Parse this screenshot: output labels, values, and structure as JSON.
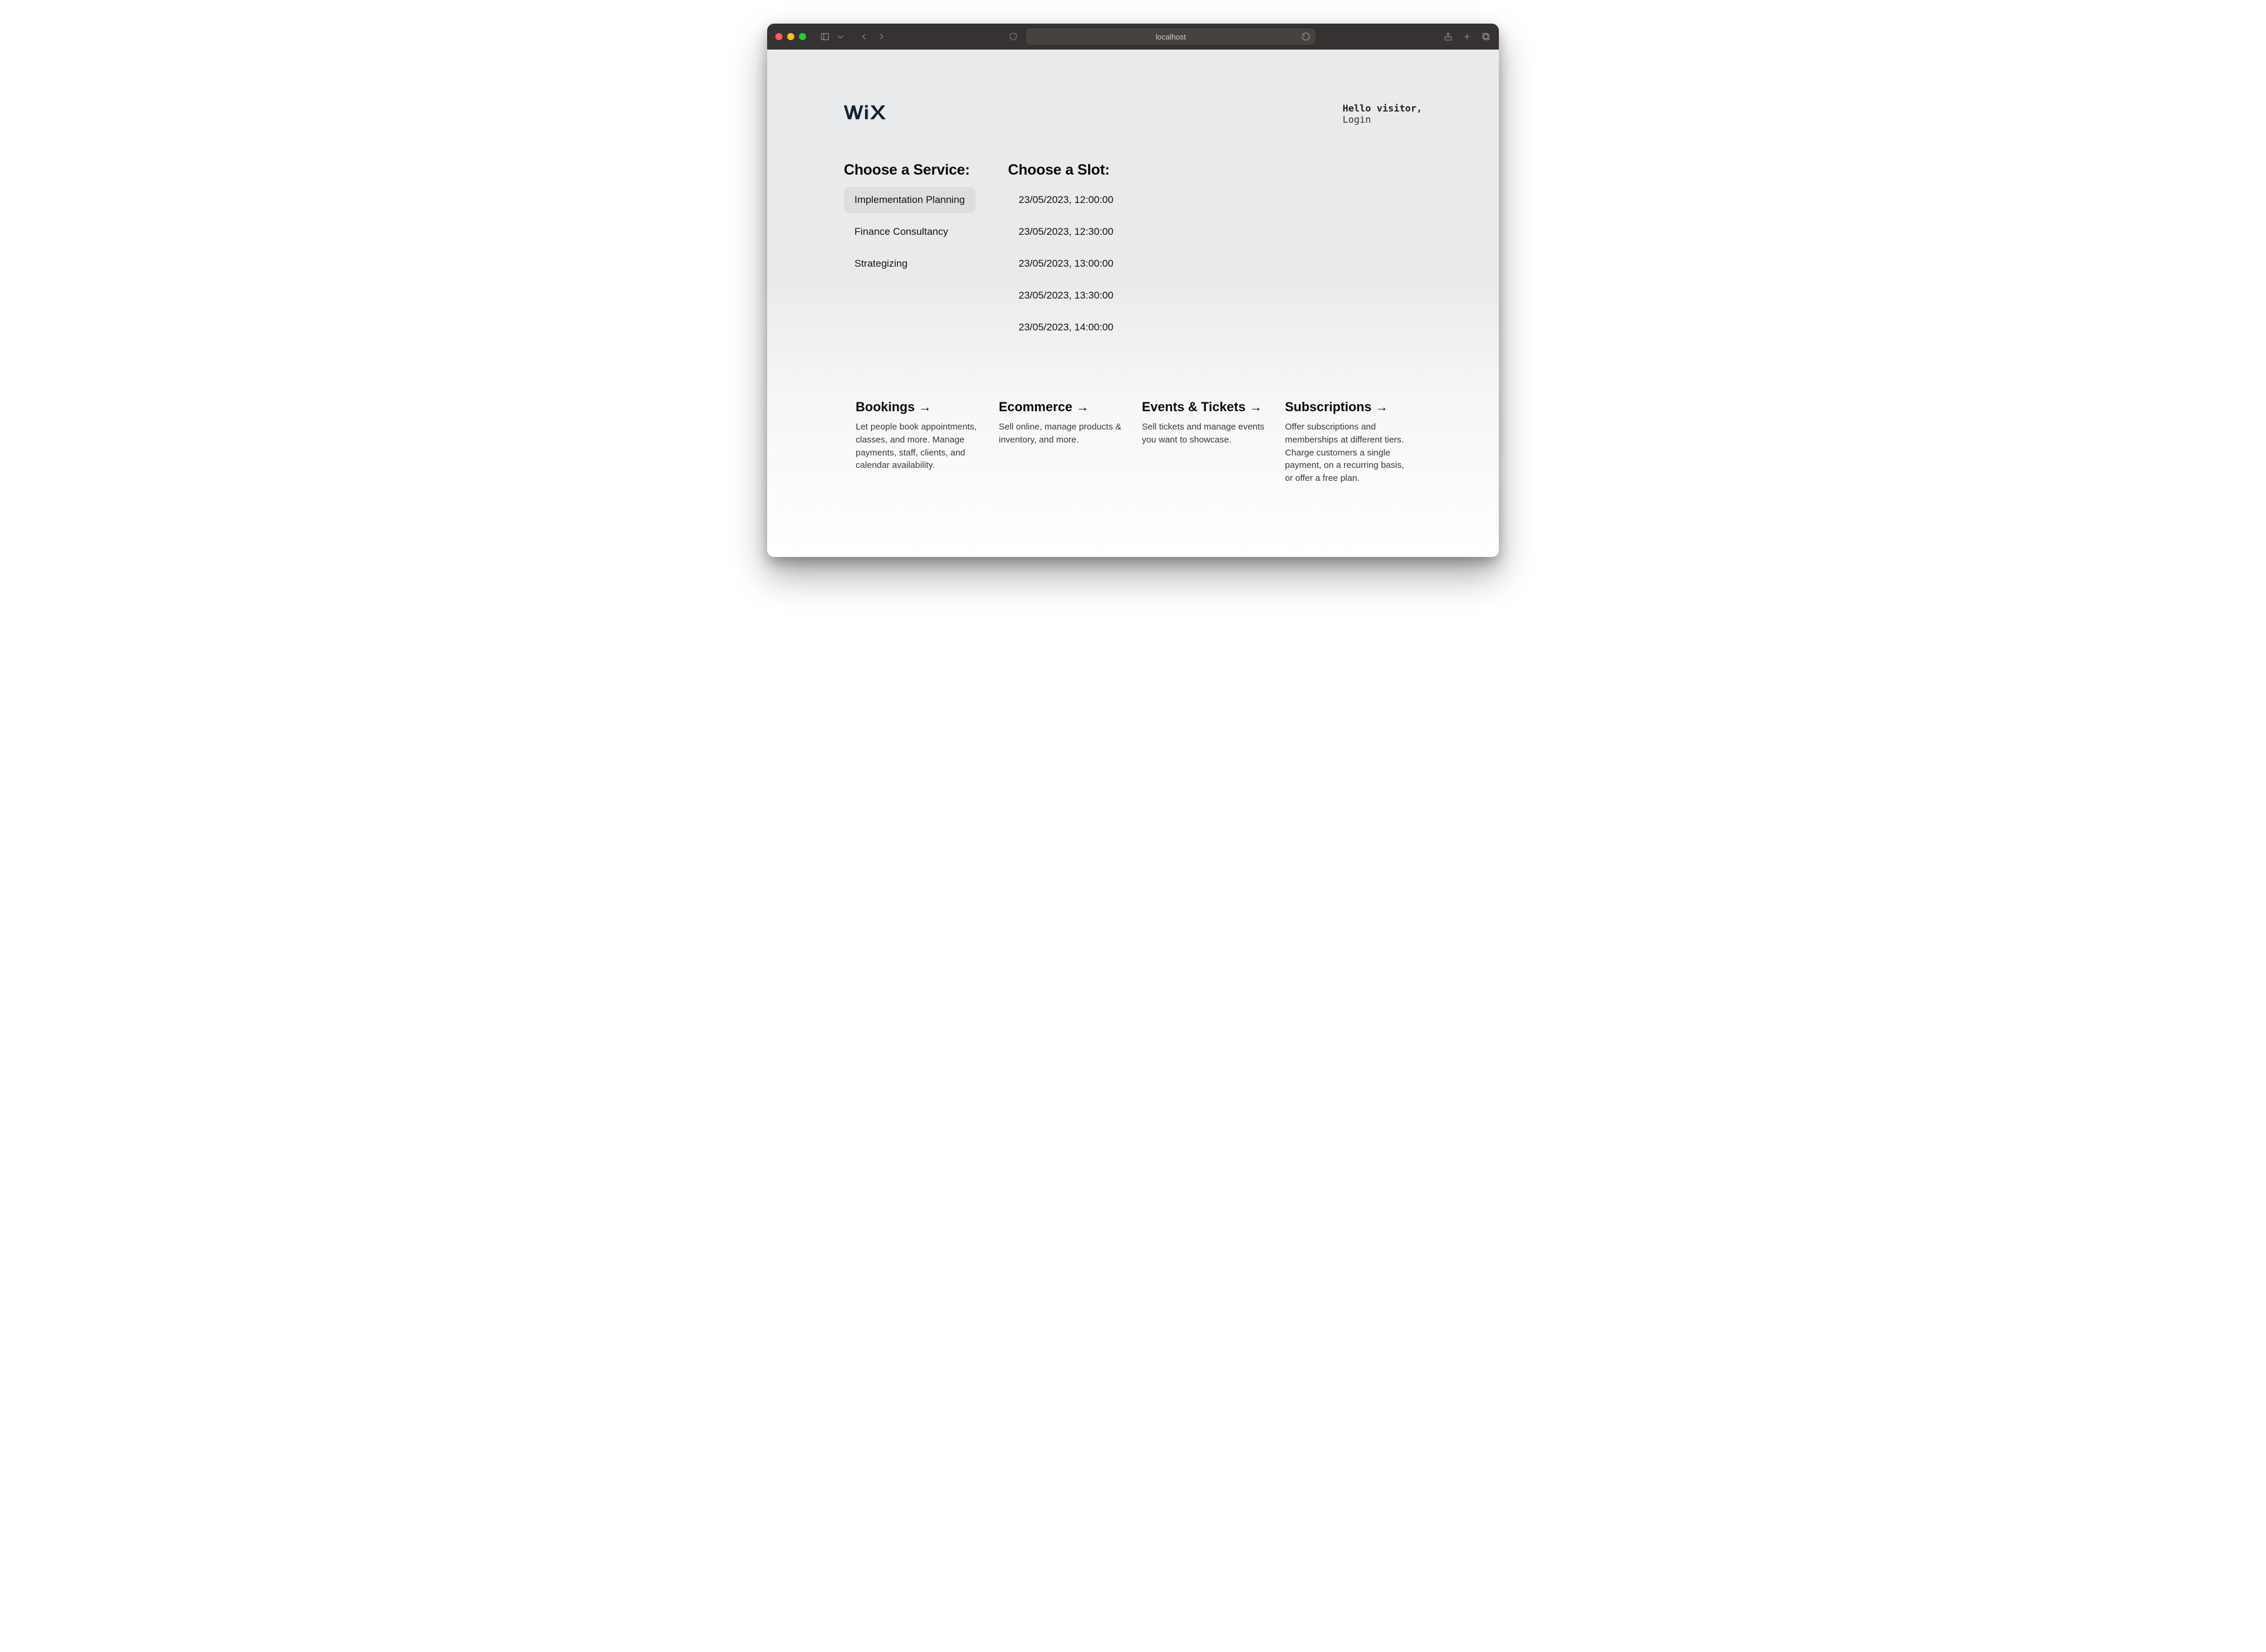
{
  "browser": {
    "address": "localhost"
  },
  "header": {
    "greeting": "Hello visitor,",
    "login_label": "Login"
  },
  "services": {
    "heading": "Choose a Service:",
    "items": [
      {
        "label": "Implementation Planning",
        "selected": true
      },
      {
        "label": "Finance Consultancy",
        "selected": false
      },
      {
        "label": "Strategizing",
        "selected": false
      }
    ]
  },
  "slots": {
    "heading": "Choose a Slot:",
    "items": [
      "23/05/2023, 12:00:00",
      "23/05/2023, 12:30:00",
      "23/05/2023, 13:00:00",
      "23/05/2023, 13:30:00",
      "23/05/2023, 14:00:00"
    ]
  },
  "features": [
    {
      "title": "Bookings →",
      "desc": "Let people book appointments, classes, and more. Manage payments, staff, clients, and calendar availability."
    },
    {
      "title": "Ecommerce →",
      "desc": "Sell online, manage products & inventory, and more."
    },
    {
      "title": "Events & Tickets →",
      "desc": "Sell tickets and manage events you want to showcase."
    },
    {
      "title": "Subscriptions →",
      "desc": "Offer subscriptions and memberships at different tiers. Charge customers a single payment, on a recurring basis, or offer a free plan."
    }
  ]
}
